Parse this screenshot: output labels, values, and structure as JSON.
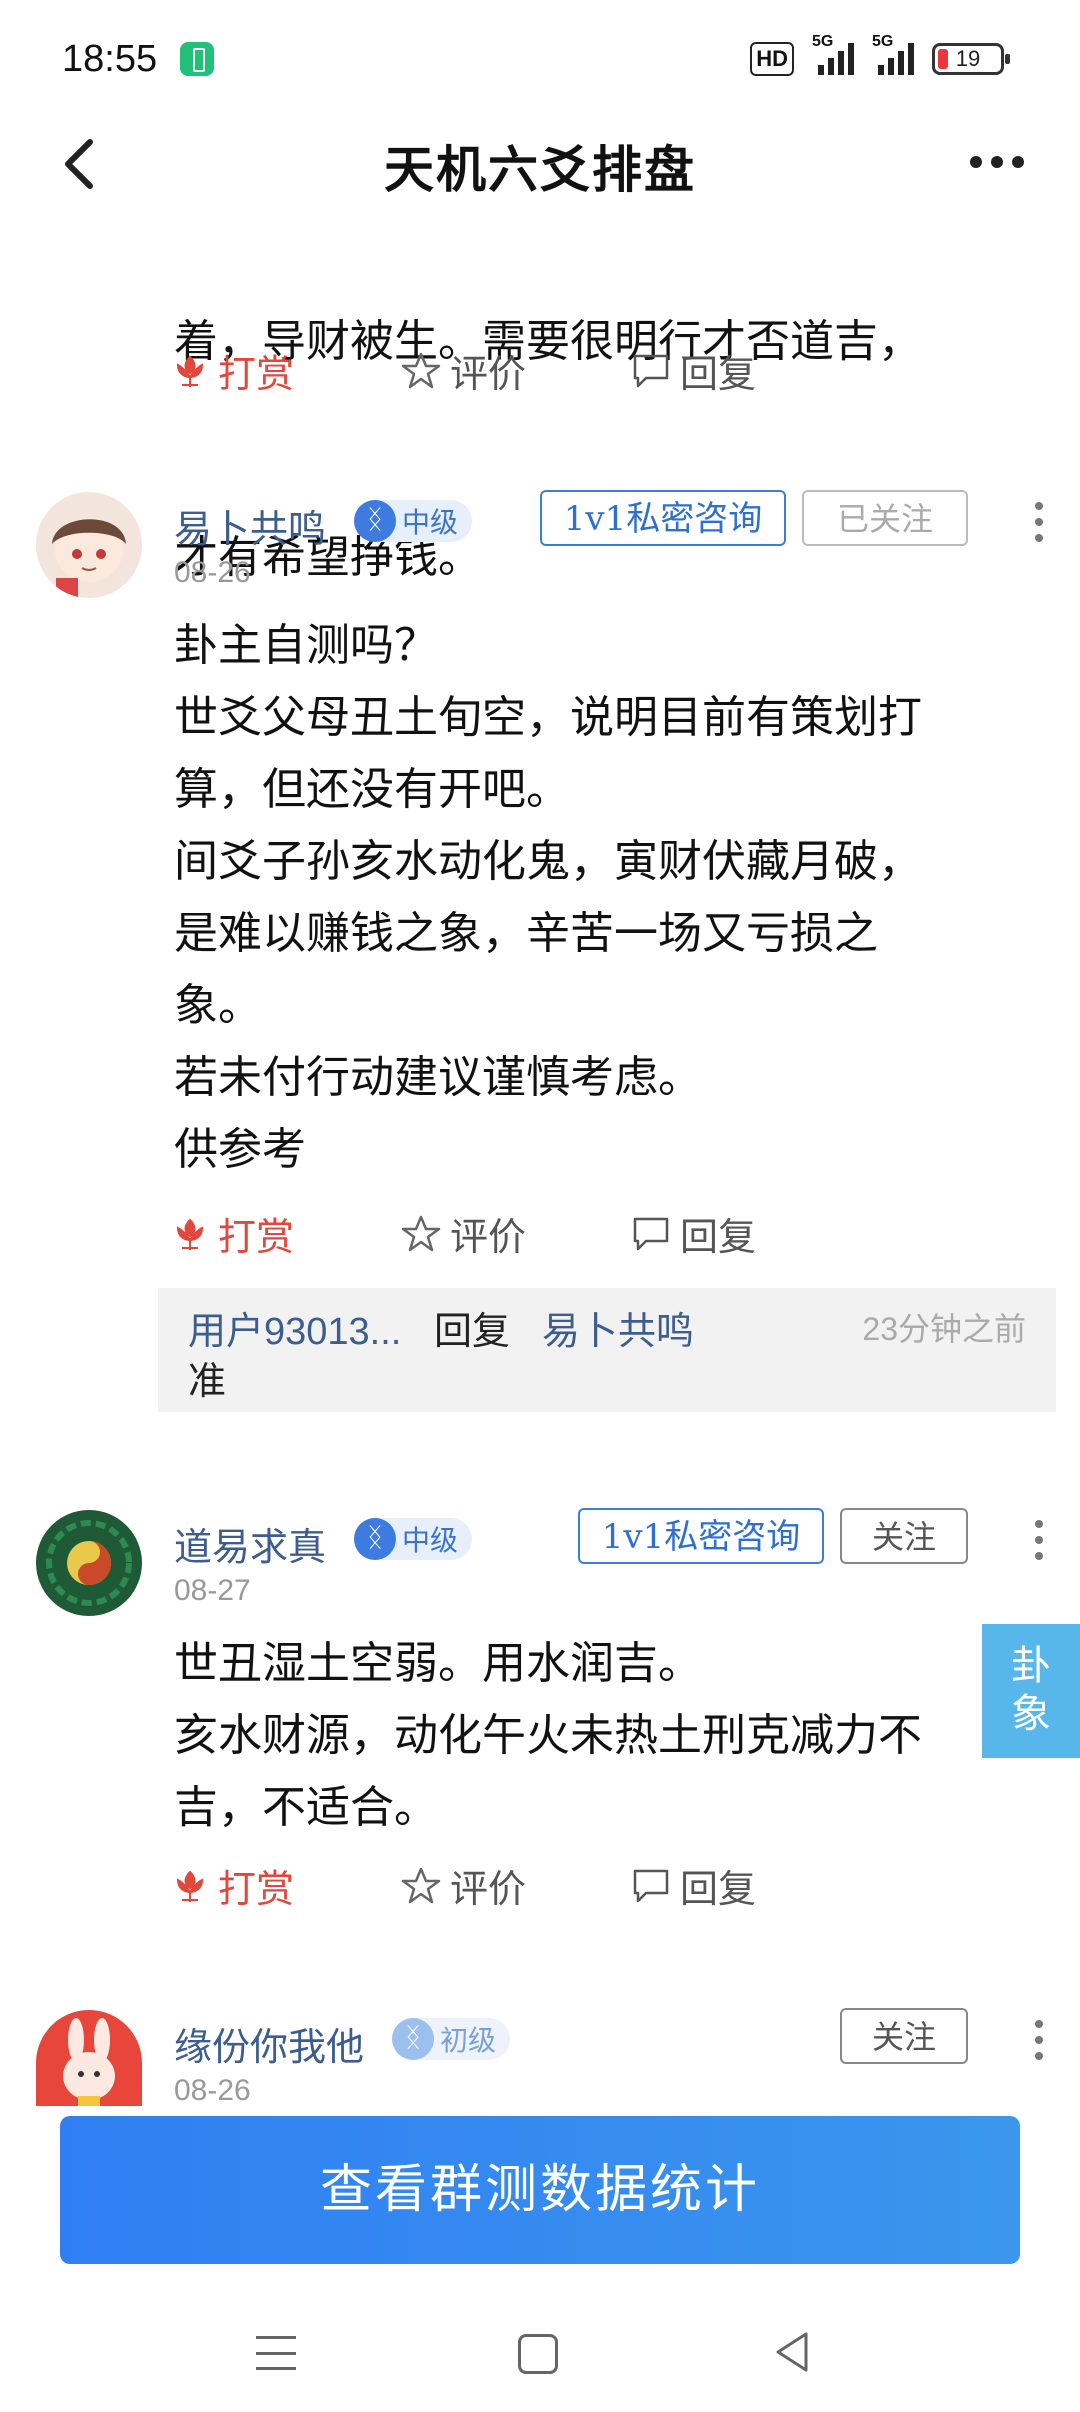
{
  "status_bar": {
    "time": "18:55",
    "hd_label": "HD",
    "sig1_label": "5G",
    "sig2_label": "5G",
    "battery_level": "19"
  },
  "title_bar": {
    "title": "天机六爻排盘"
  },
  "top_fragment": {
    "line_partial": "着，导财被生。需要很明行才否道吉，",
    "line_last": "才有希望挣钱。"
  },
  "actions": {
    "reward": "打赏",
    "rate": "评价",
    "reply": "回复"
  },
  "comments": [
    {
      "username": "易卜共鸣",
      "level": "中级",
      "date": "08-26",
      "consult_label": "1v1私密咨询",
      "follow_label": "已关注",
      "body": "卦主自测吗？\n世爻父母丑土旬空，说明目前有策划打\n算，但还没有开吧。\n间爻子孙亥水动化鬼，寅财伏藏月破，\n是难以赚钱之象，辛苦一场又亏损之\n象。\n若未付行动建议谨慎考虑。\n供参考",
      "reply": {
        "from": "用户93013...",
        "verb": "回复",
        "to": "易卜共鸣",
        "time": "23分钟之前",
        "text": "准"
      }
    },
    {
      "username": "道易求真",
      "level": "中级",
      "date": "08-27",
      "consult_label": "1v1私密咨询",
      "follow_label": "关注",
      "body": "世丑湿土空弱。用水润吉。\n亥水财源，动化午火未热土刑克减力不\n吉，不适合。"
    },
    {
      "username": "缘份你我他",
      "level": "初级",
      "date": "08-26",
      "follow_label": "关注"
    }
  ],
  "float_tab": {
    "label_1": "卦",
    "label_2": "象"
  },
  "bottom_button": {
    "label": "查看群测数据统计"
  }
}
